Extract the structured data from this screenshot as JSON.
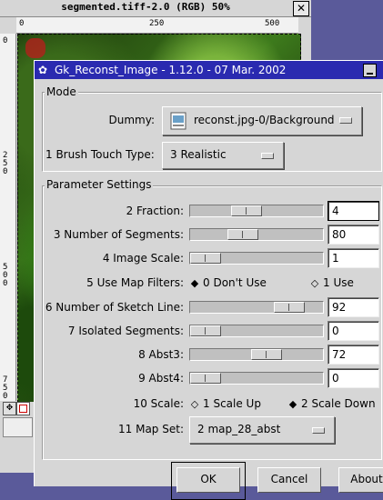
{
  "image_window": {
    "title": "segmented.tiff-2.0 (RGB) 50%",
    "close_glyph": "✕",
    "ruler_top_ticks": [
      "0",
      "250",
      "500"
    ],
    "ruler_left_ticks": [
      "0",
      "250",
      "500",
      "750"
    ]
  },
  "dialog": {
    "title": "Gk_Reconst_Image - 1.12.0 - 07 Mar. 2002",
    "mode_frame": {
      "label": "Mode",
      "dummy_label": "Dummy:",
      "dummy_value": "reconst.jpg-0/Background",
      "brush_label": "1 Brush Touch Type:",
      "brush_value": "3 Realistic"
    },
    "params_frame": {
      "label": "Parameter Settings",
      "sliders": [
        {
          "label": "2 Fraction:",
          "value": "4",
          "fraction": 0.4
        },
        {
          "label": "3 Number of Segments:",
          "value": "80",
          "fraction": 0.37
        },
        {
          "label": "4 Image Scale:",
          "value": "1",
          "fraction": 0.0
        },
        {
          "label": "6 Number of Sketch Line:",
          "value": "92",
          "fraction": 0.82
        },
        {
          "label": "7 Isolated Segments:",
          "value": "0",
          "fraction": 0.0
        },
        {
          "label": "8 Abst3:",
          "value": "72",
          "fraction": 0.6
        },
        {
          "label": "9 Abst4:",
          "value": "0",
          "fraction": 0.0
        }
      ],
      "map_filters": {
        "label": "5 Use Map Filters:",
        "option_a": "0 Don't Use",
        "option_b": "1 Use",
        "selected": "option_a"
      },
      "scale": {
        "label": "10 Scale:",
        "option_a": "1 Scale Up",
        "option_b": "2 Scale Down",
        "selected": "option_b"
      },
      "map_set": {
        "label": "11 Map Set:",
        "value": "2 map_28_abst"
      }
    },
    "buttons": {
      "ok": "OK",
      "cancel": "Cancel",
      "about": "About"
    }
  }
}
